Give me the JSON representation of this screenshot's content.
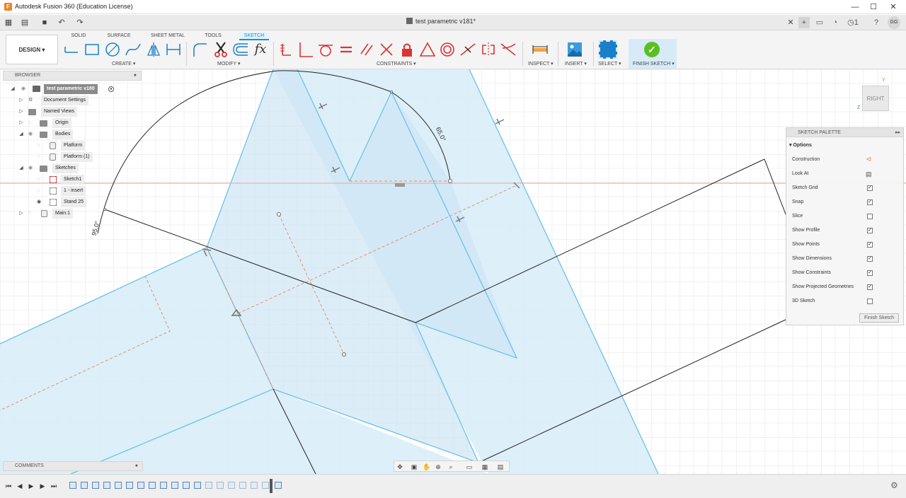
{
  "window": {
    "app_title": "Autodesk Fusion 360 (Education License)",
    "document_tab": "test parametric v181*",
    "user_initials": "GG",
    "job_count": "1"
  },
  "toolbar": {
    "design_label": "DESIGN ▾",
    "workspace_tabs": [
      "SOLID",
      "SURFACE",
      "SHEET METAL",
      "TOOLS",
      "SKETCH"
    ],
    "active_tab": "SKETCH",
    "groups": {
      "create": "CREATE ▾",
      "modify": "MODIFY ▾",
      "constraints": "CONSTRAINTS ▾",
      "inspect": "INSPECT ▾",
      "insert": "INSERT ▾",
      "select": "SELECT ▾",
      "finish_sketch": "FINISH SKETCH ▾"
    },
    "fx_label": "fx"
  },
  "browser": {
    "header": "BROWSER",
    "root": "test parametric v180",
    "items": [
      {
        "label": "Document Settings"
      },
      {
        "label": "Named Views"
      },
      {
        "label": "Origin"
      },
      {
        "label": "Bodies"
      },
      {
        "label": "Platform"
      },
      {
        "label": "Platform (1)"
      },
      {
        "label": "Sketches"
      },
      {
        "label": "Sketch1"
      },
      {
        "label": "1 - insert"
      },
      {
        "label": "Stand 25"
      },
      {
        "label": "Main:1"
      }
    ]
  },
  "palette": {
    "header": "SKETCH PALETTE",
    "section": "Options",
    "rows": [
      {
        "label": "Construction",
        "type": "icon"
      },
      {
        "label": "Look At",
        "type": "icon"
      },
      {
        "label": "Sketch Grid",
        "checked": "✓"
      },
      {
        "label": "Snap",
        "checked": "✓"
      },
      {
        "label": "Slice",
        "checked": ""
      },
      {
        "label": "Show Profile",
        "checked": "✓"
      },
      {
        "label": "Show Points",
        "checked": "✓"
      },
      {
        "label": "Show Dimensions",
        "checked": "✓"
      },
      {
        "label": "Show Constraints",
        "checked": "✓"
      },
      {
        "label": "Show Projected Geometries",
        "checked": "✓"
      },
      {
        "label": "3D Sketch",
        "checked": ""
      }
    ],
    "finish_button": "Finish Sketch"
  },
  "canvas": {
    "dim_angle_1": "65.0°",
    "dim_angle_2": "95.0°",
    "view_cube_label": "RIGHT",
    "axis_y": "Y",
    "axis_z": "Z"
  },
  "comments": {
    "label": "COMMENTS"
  },
  "colors": {
    "accent": "#0696d7",
    "profile_fill": "#d7ecf8",
    "profile_edge": "#6cc3e6",
    "construction": "#d9956a"
  }
}
